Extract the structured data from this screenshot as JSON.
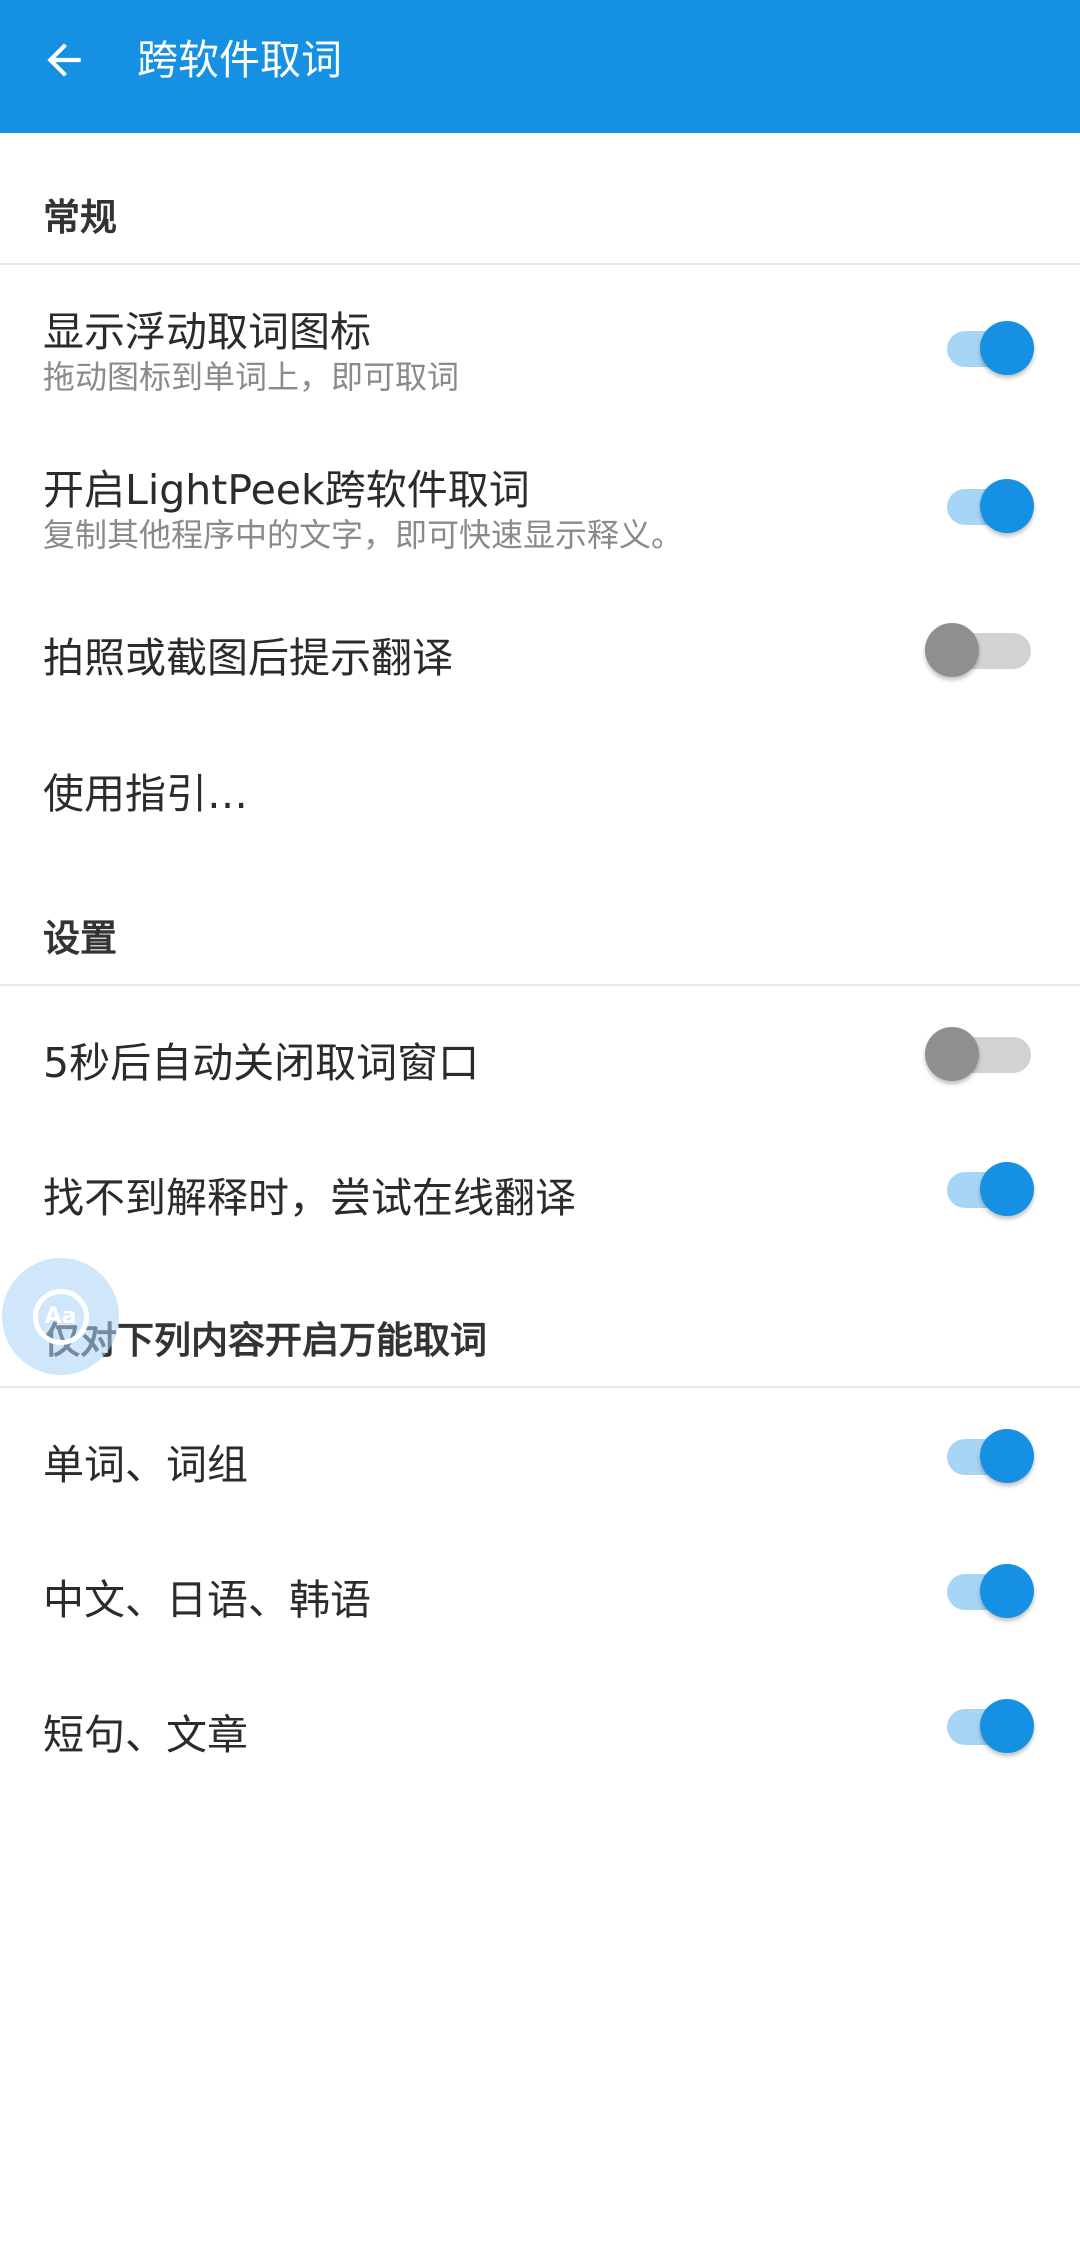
{
  "header": {
    "title": "跨软件取词",
    "back_icon": "arrow-left-icon",
    "background_color": "#1590E3"
  },
  "sections": [
    {
      "label": "常规",
      "items": [
        {
          "title": "显示浮动取词图标",
          "subtitle": "拖动图标到单词上，即可取词",
          "toggle": "on"
        },
        {
          "title": "开启LightPeek跨软件取词",
          "subtitle": "复制其他程序中的文字，即可快速显示释义。",
          "toggle": "on"
        },
        {
          "title": "拍照或截图后提示翻译",
          "toggle": "off"
        },
        {
          "title": "使用指引…"
        }
      ]
    },
    {
      "label": "设置",
      "items": [
        {
          "title": "5秒后自动关闭取词窗口",
          "toggle": "off"
        },
        {
          "title": "找不到解释时，尝试在线翻译",
          "toggle": "on"
        }
      ]
    },
    {
      "label": "仅对下列内容开启万能取词",
      "items": [
        {
          "title": "单词、词组",
          "toggle": "on"
        },
        {
          "title": "中文、日语、韩语",
          "toggle": "on"
        },
        {
          "title": "短句、文章",
          "toggle": "on"
        }
      ]
    }
  ],
  "floating_button": {
    "icon": "aa-text-icon",
    "text": "Aa"
  },
  "colors": {
    "accent": "#1590E3",
    "switch_on_track": "#A7D5F5",
    "switch_off_thumb": "#8F8F8F",
    "switch_off_track": "#D2D2D2"
  }
}
